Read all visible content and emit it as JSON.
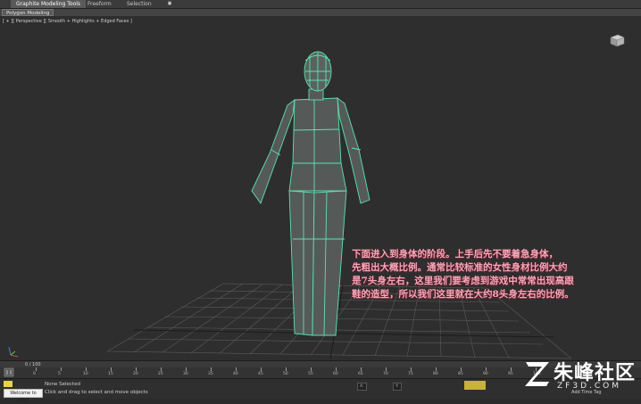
{
  "ribbon": {
    "tabs": [
      {
        "label": "Graphite Modeling Tools",
        "active": true
      },
      {
        "label": "Freeform",
        "active": false
      },
      {
        "label": "Selection",
        "active": false
      }
    ],
    "extra_button": "▣",
    "sub_tab": "Polygon Modeling"
  },
  "viewport": {
    "label": "[ + ][ Perspective ][ Smooth + Highlights + Edged Faces ]",
    "annotation_lines": [
      "下面进入到身体的阶段。上手后先不要着急身体，",
      "先粗出大概比例。通常比较标准的女性身材比例大约",
      "是7头身左右，这里我们要考虑到游戏中常常出现高跟",
      "鞋的造型，所以我们这里就在大约8头身左右的比例。"
    ],
    "colors": {
      "background": "#2e2e2e",
      "grid": "#5a5a5a",
      "mesh_fill": "#555a58",
      "wire": "#5fe0b0",
      "annotation": "#f2a8b8"
    }
  },
  "timeline": {
    "frame_label": "0 / 100",
    "ticks": [
      "0",
      "5",
      "10",
      "15",
      "20",
      "25",
      "30",
      "35",
      "40",
      "45",
      "50",
      "55",
      "60",
      "65",
      "70",
      "75",
      "80",
      "85",
      "90",
      "95",
      "100"
    ]
  },
  "status": {
    "welcome": "Welcome to MAX",
    "selection": "None Selected",
    "prompt": "Click and drag to select and move objects",
    "x_label": "X:",
    "y_label": "Y:",
    "add_time_tag": "Add Time Tag"
  },
  "watermark": {
    "brand": "朱峰社区",
    "url": "ZF3D.COM"
  }
}
